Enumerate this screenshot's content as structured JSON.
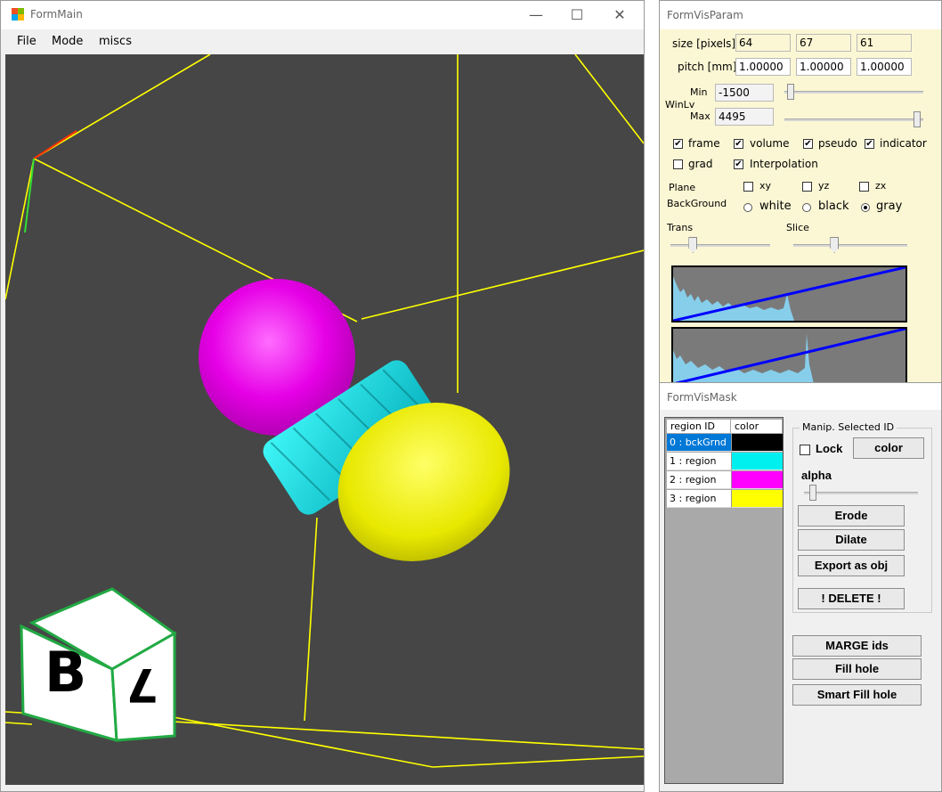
{
  "form_main": {
    "title": "FormMain",
    "menu": [
      "File",
      "Mode",
      "miscs"
    ],
    "window_controls": {
      "minimize": "—",
      "maximize": "☐",
      "close": "✕"
    },
    "orientation_cube": {
      "front": "B",
      "right": "7"
    }
  },
  "form_vis_param": {
    "title": "FormVisParam",
    "size_label": "size [pixels]",
    "size": [
      "64",
      "67",
      "61"
    ],
    "pitch_label": "pitch [mm]",
    "pitch": [
      "1.00000",
      "1.00000",
      "1.00000"
    ],
    "winlv_label": "WinLv",
    "min_label": "Min",
    "min_value": "-1500",
    "max_label": "Max",
    "max_value": "4495",
    "checkboxes": [
      {
        "label": "frame",
        "checked": true
      },
      {
        "label": "volume",
        "checked": true
      },
      {
        "label": "pseudo",
        "checked": true
      },
      {
        "label": "indicator",
        "checked": true
      },
      {
        "label": "grad",
        "checked": false
      },
      {
        "label": "Interpolation",
        "checked": true
      }
    ],
    "plane_label": "Plane",
    "planes": [
      {
        "label": "xy",
        "checked": false
      },
      {
        "label": "yz",
        "checked": false
      },
      {
        "label": "zx",
        "checked": false
      }
    ],
    "background_label": "BackGround",
    "backgrounds": [
      {
        "label": "white",
        "selected": false
      },
      {
        "label": "black",
        "selected": false
      },
      {
        "label": "gray",
        "selected": true
      }
    ],
    "trans_label": "Trans",
    "slice_label": "Slice",
    "sliders": {
      "min": 0.02,
      "max": 0.98,
      "trans": 0.2,
      "slice": 0.35
    }
  },
  "form_vis_mask": {
    "title": "FormVisMask",
    "table_headers": [
      "region ID",
      "color"
    ],
    "regions": [
      {
        "label": "0 : bckGrnd",
        "color": "#000000",
        "selected": true
      },
      {
        "label": "1 : region",
        "color": "#00f0f0",
        "selected": false
      },
      {
        "label": "2 : region",
        "color": "#ff00ff",
        "selected": false
      },
      {
        "label": "3 : region",
        "color": "#ffff00",
        "selected": false
      }
    ],
    "manip_label": "Manip. Selected ID",
    "lock_label": "Lock",
    "lock_checked": false,
    "color_button": "color",
    "alpha_label": "alpha",
    "alpha_level": 0.05,
    "erode_button": "Erode",
    "dilate_button": "Dilate",
    "export_button": "Export as obj",
    "delete_button": "! DELETE !",
    "marge_button": "MARGE ids",
    "fill_hole_button": "Fill hole",
    "smart_fill_button": "Smart Fill hole"
  },
  "colors": {
    "viewport_bg": "#464646",
    "frame_line": "#ffff00",
    "param_bg": "#fbf7d4",
    "selection": "#0078d7",
    "histogram_fill": "#87ceeb",
    "histogram_line": "#0000ff"
  }
}
